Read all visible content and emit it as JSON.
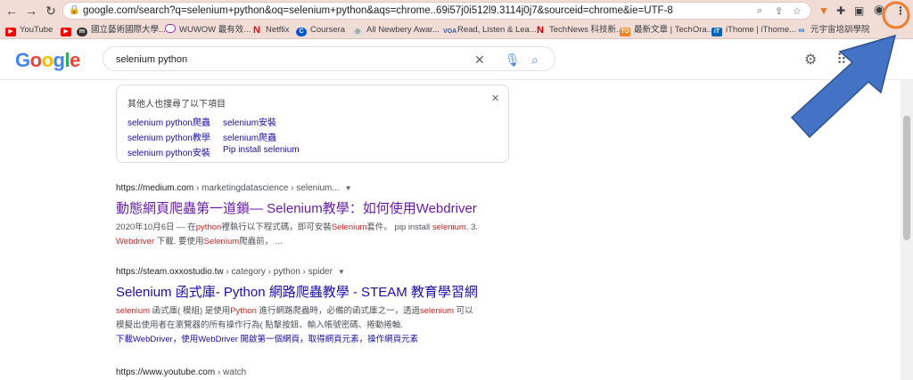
{
  "browser": {
    "url": "google.com/search?q=selenium+python&oq=selenium+python&aqs=chrome..69i57j0i512l9.3114j0j7&sourceid=chrome&ie=UTF-8",
    "bookmarks": [
      "YouTube",
      "國立藝術國際大學...",
      "WUWOW 最有效...",
      "Netflix",
      "Coursera",
      "All Newbery Awar...",
      "Read, Listen & Lea...",
      "TechNews 科技新...",
      "最新文章 | TechOra...",
      "iThome | iThome...",
      "元宇宙培訓學院"
    ]
  },
  "google": {
    "logo": "Google",
    "query": "selenium python"
  },
  "people_also": {
    "title": "其他人也搜尋了以下項目",
    "links": [
      "selenium python爬蟲",
      "selenium安裝",
      "selenium python教學",
      "selenium爬蟲",
      "selenium python安裝",
      "Pip install selenium"
    ]
  },
  "results": [
    {
      "site": "https://medium.com",
      "crumb": " › marketingdatascience › selenium...",
      "title": "動態網頁爬蟲第一道鎖— Selenium教學：如何使用Webdriver",
      "snippet_1a": "2020年10月6日 — 在",
      "snippet_1b": "python",
      "snippet_1c": "裡執行以下程式碼，即可安裝",
      "snippet_1d": "Selenium",
      "snippet_1e": "套件。 pip install ",
      "snippet_1f": "selenium",
      "snippet_1g": ". 3.",
      "snippet_2a": "Webdriver",
      "snippet_2b": " 下載. 要使用",
      "snippet_2c": "Selenium",
      "snippet_2d": "爬蟲前， ..."
    },
    {
      "site": "https://steam.oxxostudio.tw",
      "crumb": " › category › python › spider",
      "title": "Selenium 函式庫- Python 網路爬蟲教學 - STEAM 教育學習網",
      "snippet_1a": "selenium",
      "snippet_1b": " 函式庫( 模組) 是使用",
      "snippet_1c": "Python",
      "snippet_1d": " 進行網路爬蟲時，必備的函式庫之一，透過",
      "snippet_1e": "selenium",
      "snippet_1f": " 可以",
      "snippet_2": "模擬出使用者在瀏覽器的所有操作行為( 點擊按鈕、輸入帳號密碼、捲動捲軸.",
      "sitelink_1": "下載WebDriver",
      "sitelink_sep": "，",
      "sitelink_2": "使用WebDriver 開啟第一個網頁",
      "sitelink_3": "取得網頁元素",
      "sitelink_4": "操作網頁元素"
    },
    {
      "site": "https://www.youtube.com",
      "crumb": " › watch"
    }
  ],
  "colors": {
    "link": "#1a0dab",
    "visited": "#681da8",
    "highlight": "#c5221f",
    "annotation": "#4472c4",
    "annotation_circle": "#ed7d31"
  },
  "icons": [
    "back-icon",
    "forward-icon",
    "reload-icon",
    "lock-icon",
    "zoom-icon",
    "share-icon",
    "star-icon",
    "metamask-icon",
    "puzzle-icon",
    "sidebar-icon",
    "profile-icon",
    "kebab-menu-icon",
    "clear-icon",
    "mic-icon",
    "search-icon",
    "settings-gear-icon",
    "apps-grid-icon"
  ]
}
